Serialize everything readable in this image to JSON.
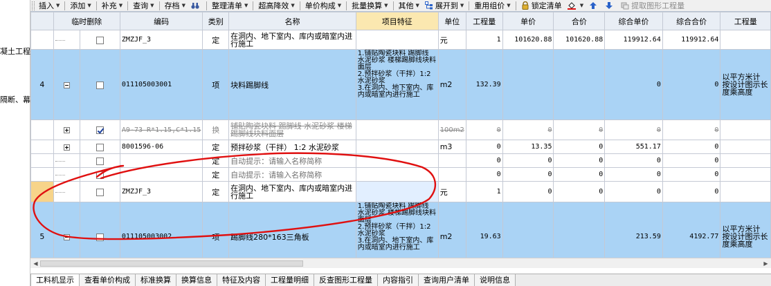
{
  "toolbar": {
    "items": [
      {
        "label": "插入",
        "dropdown": true
      },
      {
        "label": "添加",
        "dropdown": true
      },
      {
        "label": "补充",
        "dropdown": true
      },
      {
        "label": "查询",
        "dropdown": true
      },
      {
        "label": "存档",
        "dropdown": true
      },
      {
        "label": "整理清单",
        "dropdown": true
      },
      {
        "label": "超高降效",
        "dropdown": true
      },
      {
        "label": "单价构成",
        "dropdown": true
      },
      {
        "label": "批量换算",
        "dropdown": true
      },
      {
        "label": "其他",
        "dropdown": true
      },
      {
        "label": "展开到",
        "dropdown": true
      },
      {
        "label": "重用组价",
        "dropdown": true
      },
      {
        "label": "锁定清单"
      },
      {
        "label": "提取图形工程量"
      }
    ]
  },
  "left_panel": {
    "line1": "凝土工程",
    "line2": "隔断、幕"
  },
  "grid": {
    "headers": {
      "temp_delete": "临时删除",
      "code": "编码",
      "category": "类别",
      "name": "名称",
      "feature": "项目特征",
      "unit": "单位",
      "quantity": "工程量",
      "unit_price": "单价",
      "total_price": "合价",
      "comp_unit_price": "综合单价",
      "comp_total_price": "综合合价",
      "qty_expr": "工程量"
    },
    "rows": [
      {
        "kind": "sub",
        "index": "",
        "code": "ZMZJF_3",
        "category": "定",
        "name": "在洞内、地下室内、库内或暗室内进行施工",
        "feature": "",
        "unit": "元",
        "quantity": "1",
        "unit_price": "101620.88",
        "total_price": "101620.88",
        "comp_unit_price": "119912.64",
        "comp_total_price": "119912.64",
        "qty_expr": ""
      },
      {
        "kind": "item",
        "index": "4",
        "code": "011105003001",
        "category": "项",
        "name": "块料踢脚线",
        "feature": "1.铺贴陶瓷块料 踢脚线 水泥砂浆 楼梯踢脚线块料面层\n2.预拌砂浆（干拌）1:2 水泥砂浆\n3.在洞内、地下室内、库内或暗室内进行施工",
        "unit": "m2",
        "quantity": "132.39",
        "unit_price": "",
        "total_price": "",
        "comp_unit_price": "0",
        "comp_total_price": "0",
        "qty_expr": "以平方米计 按设计图示长度乘高度"
      },
      {
        "kind": "struck",
        "index": "",
        "code": "A9-73 R*1.15,C*1.15",
        "category": "换",
        "name": "铺贴陶瓷块料 踢脚线 水泥砂浆 楼梯踢脚线块料面层",
        "feature": "",
        "unit": "100m2",
        "quantity": "0",
        "unit_price": "0",
        "total_price": "0",
        "comp_unit_price": "0",
        "comp_total_price": "0",
        "qty_expr": ""
      },
      {
        "kind": "sub2",
        "index": "",
        "code": "8001596-06",
        "category": "定",
        "name": "预拌砂浆（干拌） 1:2 水泥砂浆",
        "feature": "",
        "unit": "m3",
        "quantity": "0",
        "unit_price": "13.35",
        "total_price": "0",
        "comp_unit_price": "551.17",
        "comp_total_price": "0",
        "qty_expr": ""
      },
      {
        "kind": "auto",
        "index": "",
        "code": "",
        "category": "定",
        "name": "自动提示：请输入名称简称",
        "feature": "",
        "unit": "",
        "quantity": "0",
        "unit_price": "0",
        "total_price": "0",
        "comp_unit_price": "0",
        "comp_total_price": "0",
        "qty_expr": ""
      },
      {
        "kind": "auto",
        "index": "",
        "code": "",
        "category": "定",
        "name": "自动提示：请输入名称简称",
        "feature": "",
        "unit": "",
        "quantity": "0",
        "unit_price": "0",
        "total_price": "0",
        "comp_unit_price": "0",
        "comp_total_price": "0",
        "qty_expr": ""
      },
      {
        "kind": "sub",
        "index": "",
        "code": "ZMZJF_3",
        "category": "定",
        "name": "在洞内、地下室内、库内或暗室内进行施工",
        "feature": "",
        "unit": "元",
        "quantity": "1",
        "unit_price": "0",
        "total_price": "0",
        "comp_unit_price": "0",
        "comp_total_price": "0",
        "qty_expr": ""
      },
      {
        "kind": "item",
        "index": "5",
        "code": "011105003002",
        "category": "项",
        "name": "踢脚线280*163三角板",
        "feature": "1.铺贴陶瓷块料 踢脚线 水泥砂浆 楼梯踢脚线块料面层\n2.预拌砂浆（干拌）1:2 水泥砂浆\n3.在洞内、地下室内、库内或暗室内进行施工",
        "unit": "m2",
        "quantity": "19.63",
        "unit_price": "",
        "total_price": "",
        "comp_unit_price": "213.59",
        "comp_total_price": "4192.77",
        "qty_expr": "以平方米计 按设计图示长度乘高度"
      }
    ]
  },
  "tabs": [
    {
      "label": "工料机显示",
      "active": true
    },
    {
      "label": "查看单价构成"
    },
    {
      "label": "标准换算"
    },
    {
      "label": "换算信息"
    },
    {
      "label": "特征及内容"
    },
    {
      "label": "工程量明细"
    },
    {
      "label": "反查图形工程量"
    },
    {
      "label": "内容指引"
    },
    {
      "label": "查询用户清单"
    },
    {
      "label": "说明信息"
    }
  ],
  "colors": {
    "row_blue": "#aad3f5",
    "header_bg": "#e9eef5",
    "feature_header": "#fbe8b0",
    "annotation_red": "#e01010"
  }
}
